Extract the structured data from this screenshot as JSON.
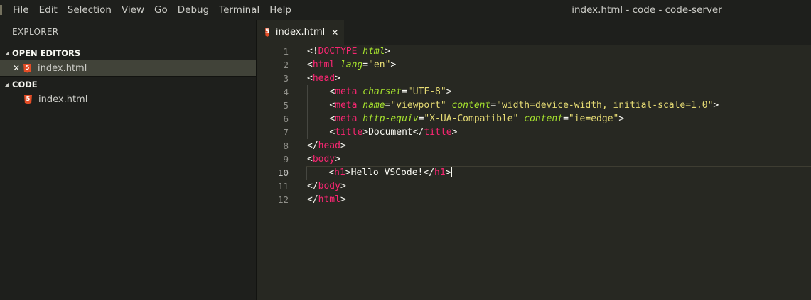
{
  "menu": [
    "File",
    "Edit",
    "Selection",
    "View",
    "Go",
    "Debug",
    "Terminal",
    "Help"
  ],
  "window_title": "index.html - code - code-server",
  "sidebar": {
    "title": "EXPLORER",
    "open_editors": {
      "label": "OPEN EDITORS",
      "files": [
        "index.html"
      ]
    },
    "folder": {
      "label": "CODE",
      "files": [
        "index.html"
      ]
    }
  },
  "tab": {
    "label": "index.html",
    "icon": "5"
  },
  "editor": {
    "line_numbers": [
      "1",
      "2",
      "3",
      "4",
      "5",
      "6",
      "7",
      "8",
      "9",
      "10",
      "11",
      "12"
    ],
    "current_line": 10,
    "lines": [
      "<!DOCTYPE html>",
      "<html lang=\"en\">",
      "<head>",
      "    <meta charset=\"UTF-8\">",
      "    <meta name=\"viewport\" content=\"width=device-width, initial-scale=1.0\">",
      "    <meta http-equiv=\"X-UA-Compatible\" content=\"ie=edge\">",
      "    <title>Document</title>",
      "</head>",
      "<body>",
      "    <h1>Hello VSCode!</h1>",
      "</body>",
      "</html>"
    ]
  },
  "colors": {
    "background": "#272822",
    "sidebar": "#1e1f1c",
    "tag": "#f92672",
    "attribute": "#a6e22e",
    "string": "#e6db74",
    "html_icon": "#e44d26"
  }
}
